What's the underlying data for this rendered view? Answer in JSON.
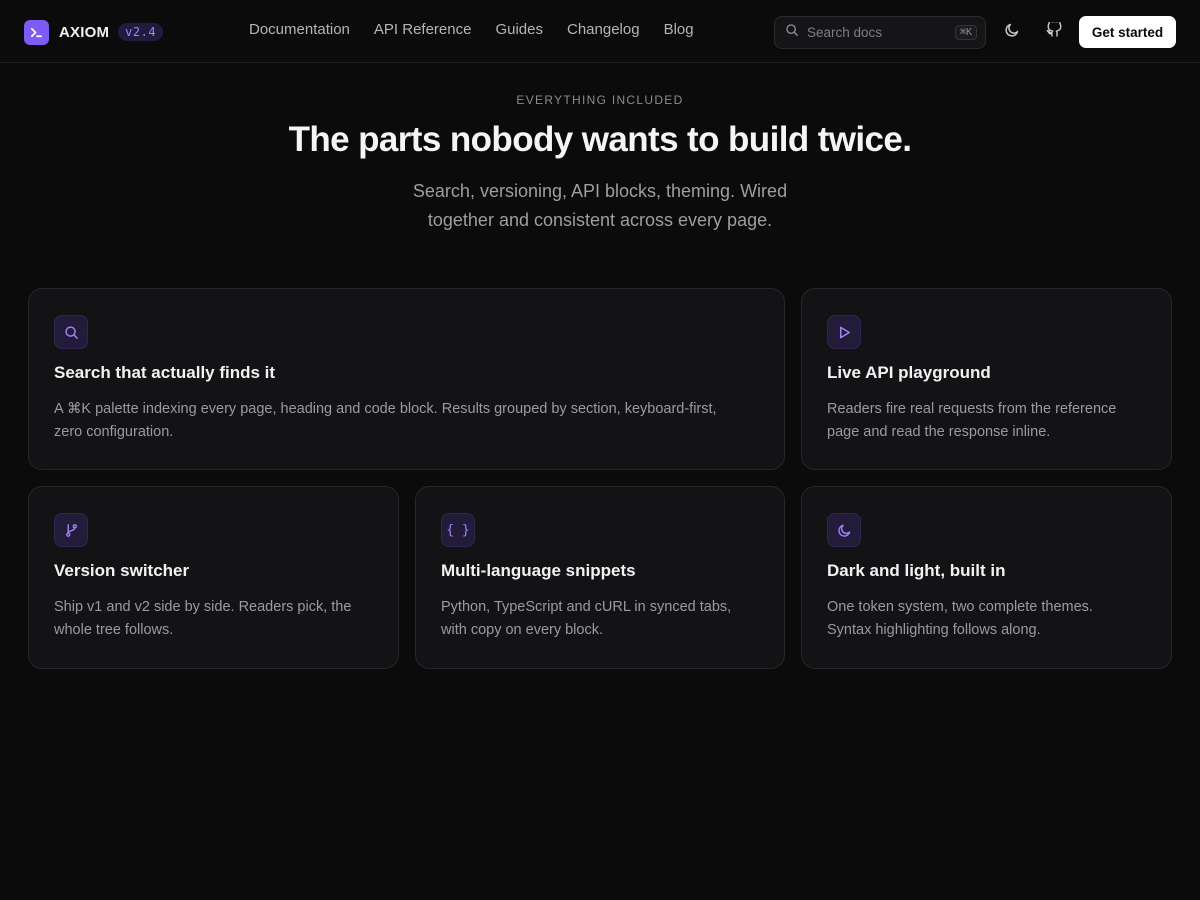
{
  "brand": {
    "name": "AXIOM",
    "version": "v2.4",
    "accent": "#7c5cf5"
  },
  "nav": {
    "links": [
      "Documentation",
      "API Reference",
      "Guides",
      "Changelog",
      "Blog"
    ],
    "search": {
      "placeholder": "Search docs",
      "shortcut": "⌘K"
    },
    "cta_label": "Get started",
    "icons": [
      "moon-icon",
      "github-icon"
    ]
  },
  "hero": {
    "eyebrow": "EVERYTHING INCLUDED",
    "headline": "The parts nobody wants to build twice.",
    "subhead_line1": "Search, versioning, API blocks, theming. Wired",
    "subhead_line2": "together and consistent across every page."
  },
  "features": [
    {
      "icon": "search-icon",
      "title": "Search that actually finds it",
      "desc_line1": "A ⌘K palette indexing every page, heading and code block. Results grouped by section, keyboard-first,",
      "desc_line2": "zero configuration."
    },
    {
      "icon": "play-icon",
      "title": "Live API playground",
      "desc_line1": "Readers fire real requests from the reference",
      "desc_line2": "page and read the response inline."
    },
    {
      "icon": "git-branch-icon",
      "title": "Version switcher",
      "desc_line1": "Ship v1 and v2 side by side. Readers pick, the",
      "desc_line2": "whole tree follows."
    },
    {
      "icon": "braces-icon",
      "icon_text": "{ }",
      "title": "Multi-language snippets",
      "desc_line1": "Python, TypeScript and cURL in synced tabs,",
      "desc_line2": "with copy on every block."
    },
    {
      "icon": "moon-icon",
      "title": "Dark and light, built in",
      "desc_line1": "One token system, two complete themes.",
      "desc_line2": "Syntax highlighting follows along."
    }
  ]
}
